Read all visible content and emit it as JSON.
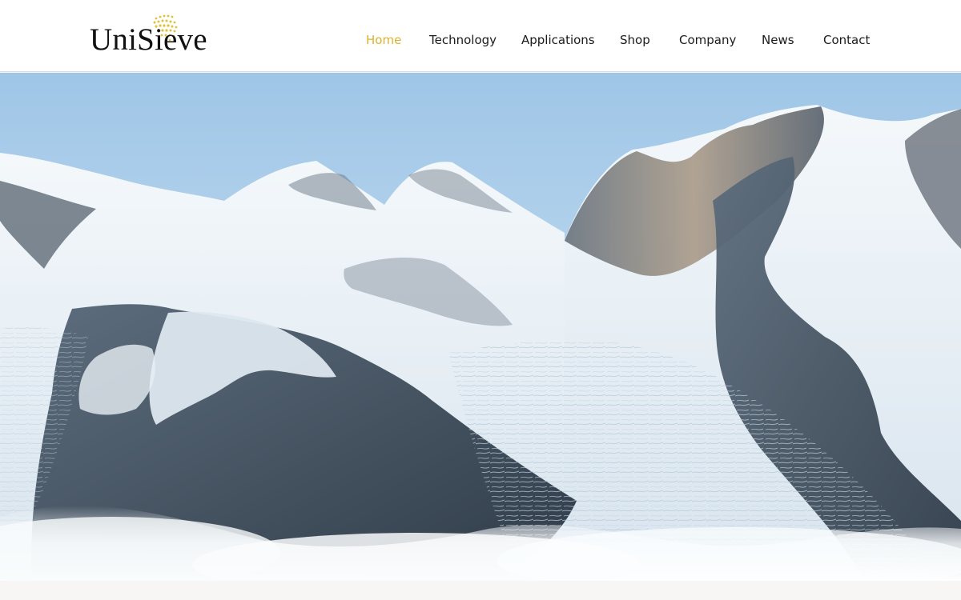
{
  "brand": {
    "name": "UniSieve",
    "accent": "#dcb22f"
  },
  "nav": {
    "items": [
      {
        "label": "Home",
        "active": true
      },
      {
        "label": "Technology",
        "active": false
      },
      {
        "label": "Applications",
        "active": false
      },
      {
        "label": "Shop",
        "active": false
      },
      {
        "label": "Company",
        "active": false
      },
      {
        "label": "News",
        "active": false
      },
      {
        "label": "Contact",
        "active": false
      }
    ]
  },
  "hero": {
    "subject": "snow-covered mountain range with glacier above clouds",
    "sky_color": "#a9cde9",
    "snow_color": "#eef4f9",
    "rock_color": "#41505f"
  }
}
